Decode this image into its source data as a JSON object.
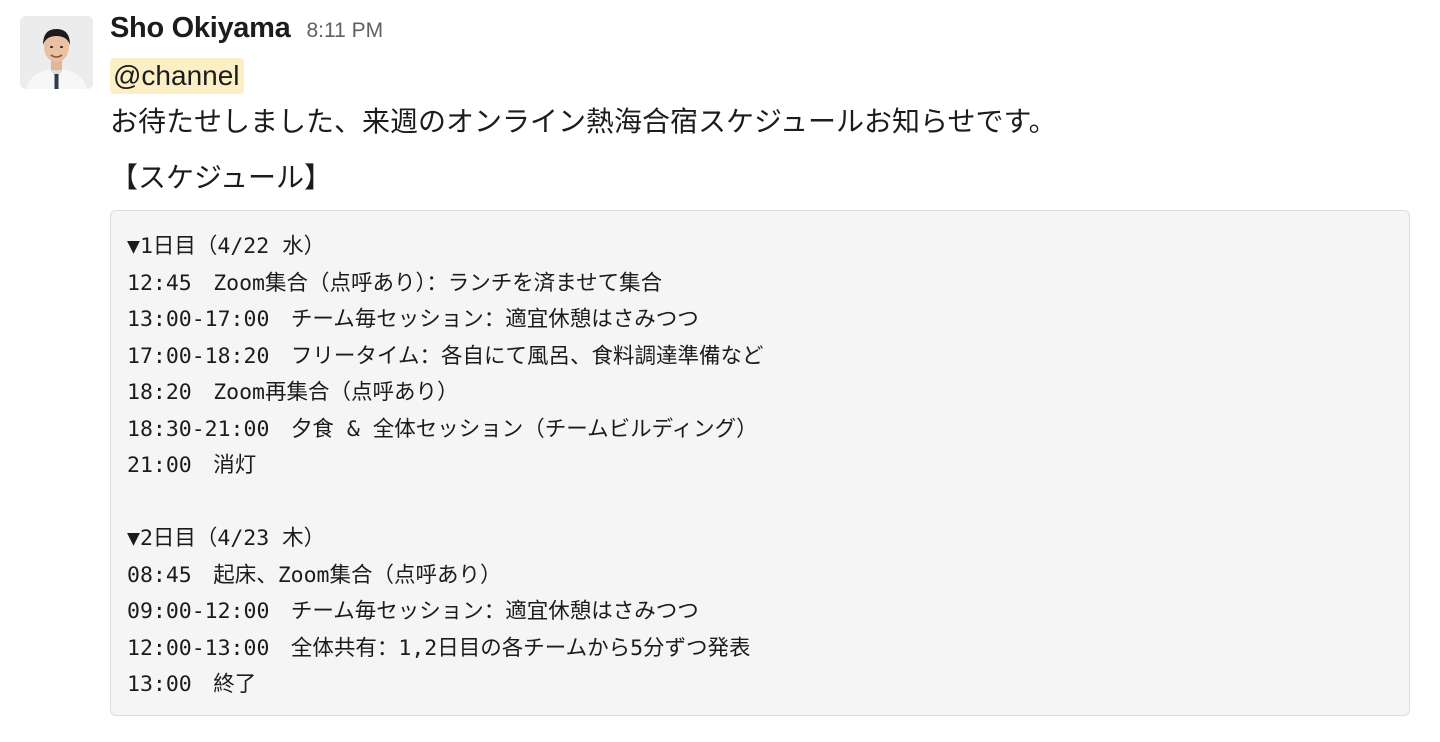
{
  "message": {
    "author": "Sho Okiyama",
    "timestamp": "8:11 PM",
    "mention": "@channel",
    "intro": "お待たせしました、来週のオンライン熱海合宿スケジュールお知らせです。",
    "schedule_heading": "【スケジュール】",
    "code_lines": [
      "▼1日目（4/22 水）",
      "12:45　Zoom集合（点呼あり）：ランチを済ませて集合",
      "13:00-17:00　チーム毎セッション：適宜休憩はさみつつ",
      "17:00-18:20　フリータイム：各自にて風呂、食料調達準備など",
      "18:20　Zoom再集合（点呼あり）",
      "18:30-21:00　夕食 & 全体セッション（チームビルディング）",
      "21:00　消灯",
      "",
      "▼2日目（4/23 木）",
      "08:45　起床、Zoom集合（点呼あり）",
      "09:00-12:00　チーム毎セッション：適宜休憩はさみつつ",
      "12:00-13:00　全体共有：1,2日目の各チームから5分ずつ発表",
      "13:00　終了"
    ]
  },
  "colors": {
    "mention_background": "#fcefc6",
    "code_background": "#f5f5f5",
    "code_border": "#dcdcdc",
    "timestamp": "#616061",
    "text": "#1d1c1d"
  }
}
